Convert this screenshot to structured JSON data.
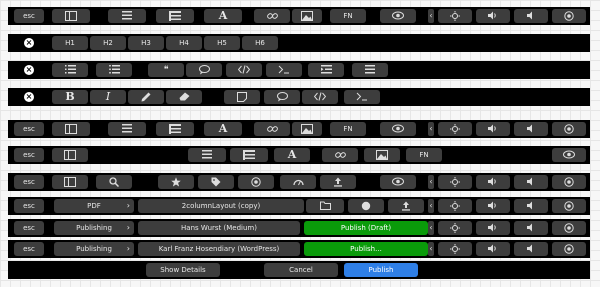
{
  "labels": {
    "esc": "esc",
    "fn": "FN",
    "bold": "B",
    "italic": "I",
    "font": "A",
    "close": "×",
    "chevron_left": "‹",
    "chevron_right": "›",
    "quote": "❝"
  },
  "headings": [
    "H1",
    "H2",
    "H3",
    "H4",
    "H5",
    "H6"
  ],
  "row7": {
    "pdf_label": "PDF",
    "layout_label": "2columnLayout (copy)"
  },
  "row8": {
    "publishing_label": "Publishing",
    "author_label": "Hans Wurst (Medium)",
    "publish_label": "Publish (Draft)"
  },
  "row9": {
    "publishing_label": "Publishing",
    "author_label": "Karl Franz Hosendiary (WordPress)",
    "publish_label": "Publish..."
  },
  "dialog": {
    "show_details": "Show Details",
    "cancel": "Cancel",
    "publish": "Publish"
  },
  "colors": {
    "bar": "#000000",
    "key": "#3d3d3d",
    "publish_green": "#0a9b0a",
    "publish_blue": "#2f7fe6"
  },
  "icons": [
    "sidebar-icon",
    "list-icon",
    "table-icon",
    "link-icon",
    "image-icon",
    "eye-icon",
    "brightness-icon",
    "volume-icon",
    "mute-icon",
    "power-icon",
    "numbered-list-icon",
    "bullet-list-icon",
    "comment-icon",
    "code-icon",
    "terminal-icon",
    "indent-icon",
    "pencil-icon",
    "eraser-icon",
    "note-icon",
    "search-icon",
    "star-icon",
    "tag-icon",
    "clock-icon",
    "upload-icon",
    "folder-icon",
    "gear-icon",
    "dashboard-icon"
  ]
}
